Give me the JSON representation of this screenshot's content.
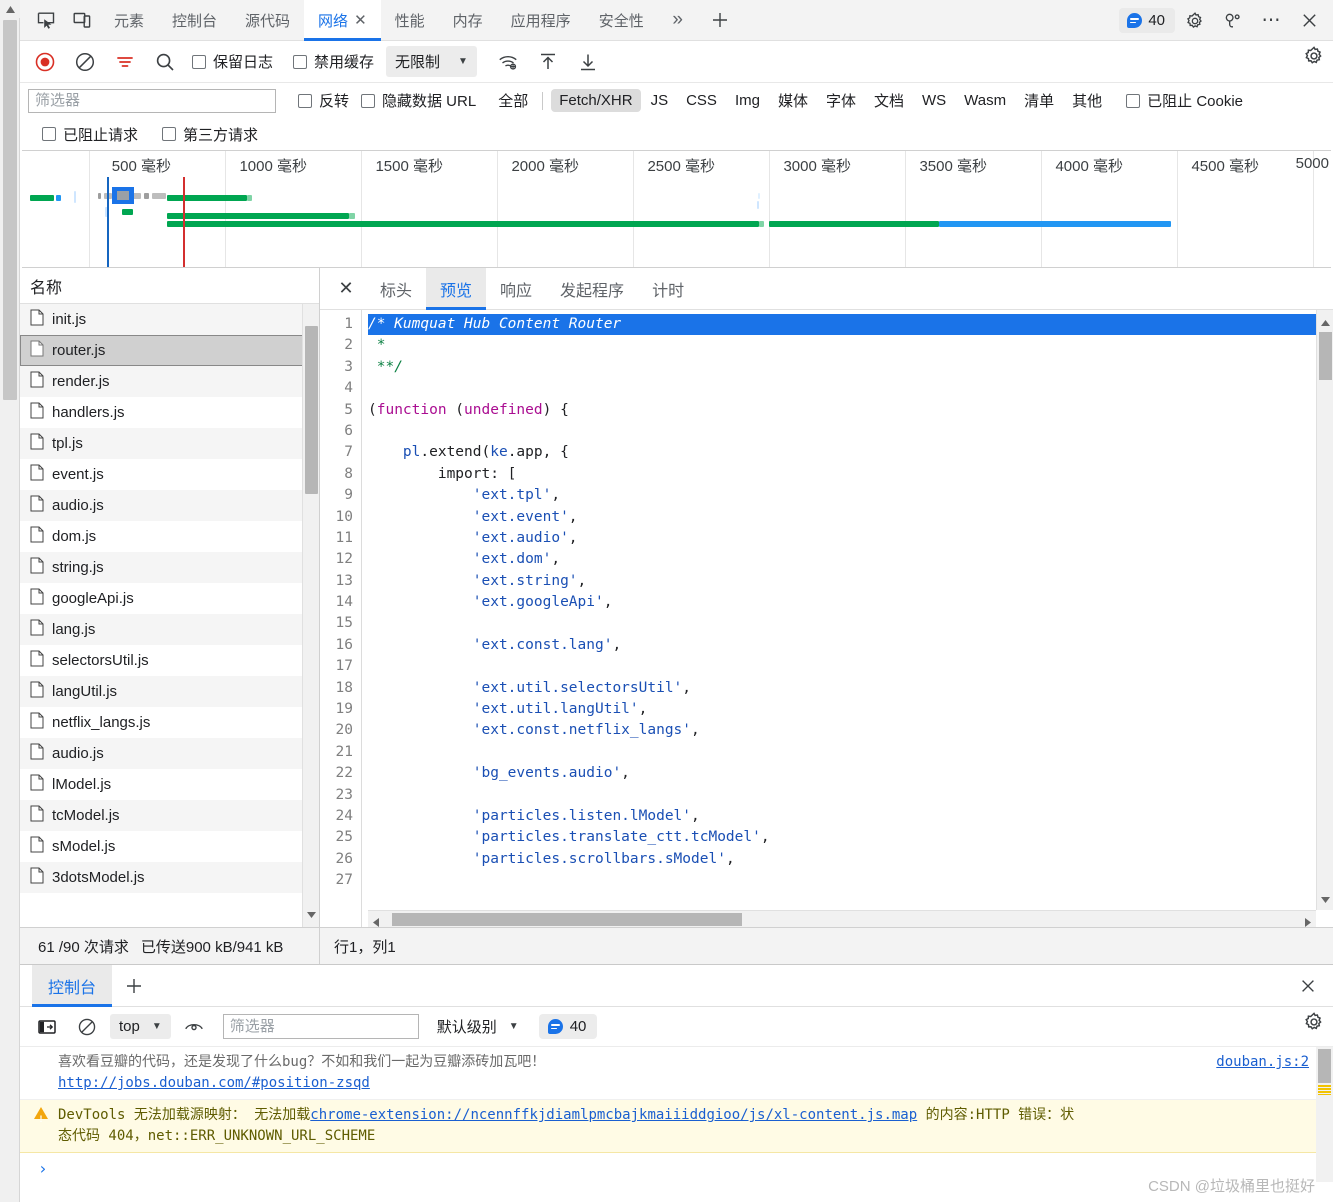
{
  "window": {
    "tabs": [
      {
        "label": "元素",
        "active": false
      },
      {
        "label": "控制台",
        "active": false
      },
      {
        "label": "源代码",
        "active": false
      },
      {
        "label": "网络",
        "active": true,
        "closable": true
      },
      {
        "label": "性能",
        "active": false
      },
      {
        "label": "内存",
        "active": false
      },
      {
        "label": "应用程序",
        "active": false
      },
      {
        "label": "安全性",
        "active": false
      }
    ],
    "more_label": "»",
    "plus_label": "+",
    "message_count": "40",
    "close_label": "✕",
    "dots_label": "⋯"
  },
  "network_toolbar": {
    "preserve_log_label": "保留日志",
    "disable_cache_label": "禁用缓存",
    "throttle_value": "无限制",
    "caret": "▼"
  },
  "filter_bar": {
    "filter_placeholder": "筛选器",
    "filter_value": "",
    "invert_label": "反转",
    "hide_data_urls_label": "隐藏数据 URL",
    "types": [
      {
        "label": "全部",
        "selected": false
      },
      {
        "label": "Fetch/XHR",
        "selected": true
      },
      {
        "label": "JS",
        "selected": false
      },
      {
        "label": "CSS",
        "selected": false
      },
      {
        "label": "Img",
        "selected": false
      },
      {
        "label": "媒体",
        "selected": false
      },
      {
        "label": "字体",
        "selected": false
      },
      {
        "label": "文档",
        "selected": false
      },
      {
        "label": "WS",
        "selected": false
      },
      {
        "label": "Wasm",
        "selected": false
      },
      {
        "label": "清单",
        "selected": false
      },
      {
        "label": "其他",
        "selected": false
      }
    ],
    "blocked_cookies_label": "已阻止 Cookie",
    "blocked_requests_label": "已阻止请求",
    "third_party_label": "第三方请求"
  },
  "overview": {
    "unit": "毫秒",
    "ticks": [
      "500 毫秒",
      "1000 毫秒",
      "1500 毫秒",
      "2000 毫秒",
      "2500 毫秒",
      "3000 毫秒",
      "3500 毫秒",
      "4000 毫秒",
      "4500 毫秒",
      "5000"
    ],
    "colors": {
      "green": "#00a651",
      "blue": "#2196f3",
      "dom_marker": "#1565c0",
      "load_marker": "#d32f2f"
    }
  },
  "requests": {
    "column_header": "名称",
    "items": [
      {
        "name": "init.js",
        "selected": false
      },
      {
        "name": "router.js",
        "selected": true
      },
      {
        "name": "render.js",
        "selected": false
      },
      {
        "name": "handlers.js",
        "selected": false
      },
      {
        "name": "tpl.js",
        "selected": false
      },
      {
        "name": "event.js",
        "selected": false
      },
      {
        "name": "audio.js",
        "selected": false
      },
      {
        "name": "dom.js",
        "selected": false
      },
      {
        "name": "string.js",
        "selected": false
      },
      {
        "name": "googleApi.js",
        "selected": false
      },
      {
        "name": "lang.js",
        "selected": false
      },
      {
        "name": "selectorsUtil.js",
        "selected": false
      },
      {
        "name": "langUtil.js",
        "selected": false
      },
      {
        "name": "netflix_langs.js",
        "selected": false
      },
      {
        "name": "audio.js",
        "selected": false
      },
      {
        "name": "lModel.js",
        "selected": false
      },
      {
        "name": "tcModel.js",
        "selected": false
      },
      {
        "name": "sModel.js",
        "selected": false
      },
      {
        "name": "3dotsModel.js",
        "selected": false
      }
    ]
  },
  "preview": {
    "close_label": "✕",
    "tabs": [
      {
        "label": "标头",
        "active": false
      },
      {
        "label": "预览",
        "active": true
      },
      {
        "label": "响应",
        "active": false
      },
      {
        "label": "发起程序",
        "active": false
      },
      {
        "label": "计时",
        "active": false
      }
    ],
    "code_lines": [
      {
        "n": 1,
        "highlight": true,
        "tokens": [
          {
            "t": "comment",
            "s": "/* Kumquat Hub Content Router"
          }
        ]
      },
      {
        "n": 2,
        "highlight": false,
        "tokens": [
          {
            "t": "comment",
            "s": " *"
          }
        ]
      },
      {
        "n": 3,
        "highlight": false,
        "tokens": [
          {
            "t": "comment",
            "s": " **/"
          }
        ]
      },
      {
        "n": 4,
        "highlight": false,
        "tokens": []
      },
      {
        "n": 5,
        "highlight": false,
        "tokens": [
          {
            "t": "plain",
            "s": "("
          },
          {
            "t": "kw",
            "s": "function"
          },
          {
            "t": "plain",
            "s": " ("
          },
          {
            "t": "kw",
            "s": "undefined"
          },
          {
            "t": "plain",
            "s": ") {"
          }
        ]
      },
      {
        "n": 6,
        "highlight": false,
        "tokens": []
      },
      {
        "n": 7,
        "highlight": false,
        "tokens": [
          {
            "t": "plain",
            "s": "    "
          },
          {
            "t": "str",
            "s": "pl"
          },
          {
            "t": "plain",
            "s": ".extend("
          },
          {
            "t": "str",
            "s": "ke"
          },
          {
            "t": "plain",
            "s": ".app, {"
          }
        ]
      },
      {
        "n": 8,
        "highlight": false,
        "tokens": [
          {
            "t": "plain",
            "s": "        import: ["
          }
        ]
      },
      {
        "n": 9,
        "highlight": false,
        "tokens": [
          {
            "t": "plain",
            "s": "            "
          },
          {
            "t": "str",
            "s": "'ext.tpl'"
          },
          {
            "t": "plain",
            "s": ","
          }
        ]
      },
      {
        "n": 10,
        "highlight": false,
        "tokens": [
          {
            "t": "plain",
            "s": "            "
          },
          {
            "t": "str",
            "s": "'ext.event'"
          },
          {
            "t": "plain",
            "s": ","
          }
        ]
      },
      {
        "n": 11,
        "highlight": false,
        "tokens": [
          {
            "t": "plain",
            "s": "            "
          },
          {
            "t": "str",
            "s": "'ext.audio'"
          },
          {
            "t": "plain",
            "s": ","
          }
        ]
      },
      {
        "n": 12,
        "highlight": false,
        "tokens": [
          {
            "t": "plain",
            "s": "            "
          },
          {
            "t": "str",
            "s": "'ext.dom'"
          },
          {
            "t": "plain",
            "s": ","
          }
        ]
      },
      {
        "n": 13,
        "highlight": false,
        "tokens": [
          {
            "t": "plain",
            "s": "            "
          },
          {
            "t": "str",
            "s": "'ext.string'"
          },
          {
            "t": "plain",
            "s": ","
          }
        ]
      },
      {
        "n": 14,
        "highlight": false,
        "tokens": [
          {
            "t": "plain",
            "s": "            "
          },
          {
            "t": "str",
            "s": "'ext.googleApi'"
          },
          {
            "t": "plain",
            "s": ","
          }
        ]
      },
      {
        "n": 15,
        "highlight": false,
        "tokens": []
      },
      {
        "n": 16,
        "highlight": false,
        "tokens": [
          {
            "t": "plain",
            "s": "            "
          },
          {
            "t": "str",
            "s": "'ext.const.lang'"
          },
          {
            "t": "plain",
            "s": ","
          }
        ]
      },
      {
        "n": 17,
        "highlight": false,
        "tokens": []
      },
      {
        "n": 18,
        "highlight": false,
        "tokens": [
          {
            "t": "plain",
            "s": "            "
          },
          {
            "t": "str",
            "s": "'ext.util.selectorsUtil'"
          },
          {
            "t": "plain",
            "s": ","
          }
        ]
      },
      {
        "n": 19,
        "highlight": false,
        "tokens": [
          {
            "t": "plain",
            "s": "            "
          },
          {
            "t": "str",
            "s": "'ext.util.langUtil'"
          },
          {
            "t": "plain",
            "s": ","
          }
        ]
      },
      {
        "n": 20,
        "highlight": false,
        "tokens": [
          {
            "t": "plain",
            "s": "            "
          },
          {
            "t": "str",
            "s": "'ext.const.netflix_langs'"
          },
          {
            "t": "plain",
            "s": ","
          }
        ]
      },
      {
        "n": 21,
        "highlight": false,
        "tokens": []
      },
      {
        "n": 22,
        "highlight": false,
        "tokens": [
          {
            "t": "plain",
            "s": "            "
          },
          {
            "t": "str",
            "s": "'bg_events.audio'"
          },
          {
            "t": "plain",
            "s": ","
          }
        ]
      },
      {
        "n": 23,
        "highlight": false,
        "tokens": []
      },
      {
        "n": 24,
        "highlight": false,
        "tokens": [
          {
            "t": "plain",
            "s": "            "
          },
          {
            "t": "str",
            "s": "'particles.listen.lModel'"
          },
          {
            "t": "plain",
            "s": ","
          }
        ]
      },
      {
        "n": 25,
        "highlight": false,
        "tokens": [
          {
            "t": "plain",
            "s": "            "
          },
          {
            "t": "str",
            "s": "'particles.translate_ctt.tcModel'"
          },
          {
            "t": "plain",
            "s": ","
          }
        ]
      },
      {
        "n": 26,
        "highlight": false,
        "tokens": [
          {
            "t": "plain",
            "s": "            "
          },
          {
            "t": "str",
            "s": "'particles.scrollbars.sModel'"
          },
          {
            "t": "plain",
            "s": ","
          }
        ]
      },
      {
        "n": 27,
        "highlight": false,
        "tokens": []
      }
    ]
  },
  "status_bar": {
    "requests_text": "61 /90 次请求",
    "transferred_text": "已传送900 kB/941 kB",
    "cursor_text": "行1，列1"
  },
  "console": {
    "tab_label": "控制台",
    "plus_label": "+",
    "close_label": "✕",
    "context_value": "top",
    "context_caret": "▼",
    "filter_placeholder": "筛选器",
    "filter_value": "",
    "level_label": "默认级别",
    "level_caret": "▼",
    "message_count": "40",
    "prompt_symbol": "›",
    "messages": [
      {
        "type": "info",
        "text": "喜欢看豆瓣的代码，还是发现了什么bug？不如和我们一起为豆瓣添砖加瓦吧！",
        "link": "http://jobs.douban.com/#position-zsqd",
        "source": "douban.js:2"
      },
      {
        "type": "warn",
        "prefix": "DevTools 无法加载源映射：  无法加载",
        "link": "chrome-extension://ncennffkjdiamlpmcbajkmaiiiddgioo/js/xl-content.js.map",
        "suffix": " 的内容:HTTP 错误：状",
        "line2": "态代码 404，net::ERR_UNKNOWN_URL_SCHEME"
      }
    ]
  },
  "watermark": "CSDN @垃圾桶里也挺好"
}
